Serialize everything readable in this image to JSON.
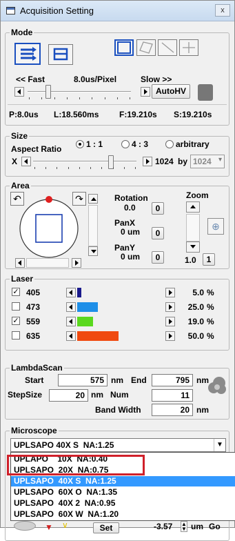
{
  "window": {
    "title": "Acquisition Setting",
    "close_label": "x"
  },
  "mode": {
    "label": "Mode",
    "fast_label": "<< Fast",
    "speed_value": "8.0us/Pixel",
    "slow_label": "Slow >>",
    "autohv_label": "AutoHV",
    "scan_speed_fraction": 0.2,
    "stats": {
      "p": "P:8.0us",
      "l": "L:18.560ms",
      "f": "F:19.210s",
      "s": "S:19.210s"
    }
  },
  "size": {
    "label": "Size",
    "aspect_label": "Aspect Ratio",
    "option_1": "1 : 1",
    "option_2": "4 : 3",
    "option_3": "arbitrary",
    "x_label": "X",
    "x_value": "1024",
    "by_label": "by",
    "y_value": "1024",
    "x_fraction": 0.75
  },
  "area": {
    "label": "Area",
    "rotation_label": "Rotation",
    "rotation_value": "0.0",
    "rotation_btn": "0",
    "panx_label": "PanX",
    "panx_value": "0 um",
    "panx_btn": "0",
    "pany_label": "PanY",
    "pany_value": "0 um",
    "pany_btn": "0",
    "zoom_label": "Zoom",
    "zoom_value": "1.0",
    "zoom_btn": "1"
  },
  "laser": {
    "label": "Laser",
    "lines": [
      {
        "wavelength": "405",
        "checked": true,
        "value": "5.0",
        "unit": "%",
        "color": "#1a1a8c",
        "fraction": 0.05
      },
      {
        "wavelength": "473",
        "checked": false,
        "value": "25.0",
        "unit": "%",
        "color": "#1e8fe8",
        "fraction": 0.25
      },
      {
        "wavelength": "559",
        "checked": true,
        "value": "19.0",
        "unit": "%",
        "color": "#5ad81e",
        "fraction": 0.19
      },
      {
        "wavelength": "635",
        "checked": false,
        "value": "50.0",
        "unit": "%",
        "color": "#f04a10",
        "fraction": 0.5
      }
    ]
  },
  "lambda": {
    "label": "LambdaScan",
    "start_label": "Start",
    "start_value": "575",
    "nm": "nm",
    "end_label": "End",
    "end_value": "795",
    "stepsize_label": "StepSize",
    "stepsize_value": "20",
    "num_label": "Num",
    "num_value": "11",
    "bandwidth_label": "Band Width",
    "bandwidth_value": "20"
  },
  "microscope": {
    "label": "Microscope",
    "selected": "UPLSAPO 40X S  NA:1.25",
    "options": [
      "UPLAPO    10X  NA:0.40",
      "UPLSAPO  20X  NA:0.75",
      "UPLSAPO  40X S  NA:1.25",
      "UPLSAPO  60X O  NA:1.35",
      "UPLSAPO  40X 2  NA:0.95",
      "UPLSAPO  60X W  NA:1.20"
    ],
    "highlight_index": 2,
    "set_label": "Set",
    "focus_value": "-3.57",
    "focus_unit": "um",
    "go_label": "Go"
  },
  "colors": {
    "highlight": "#3399ff",
    "selection_border": "#d0202a",
    "accent_blue": "#1a4fbf"
  }
}
